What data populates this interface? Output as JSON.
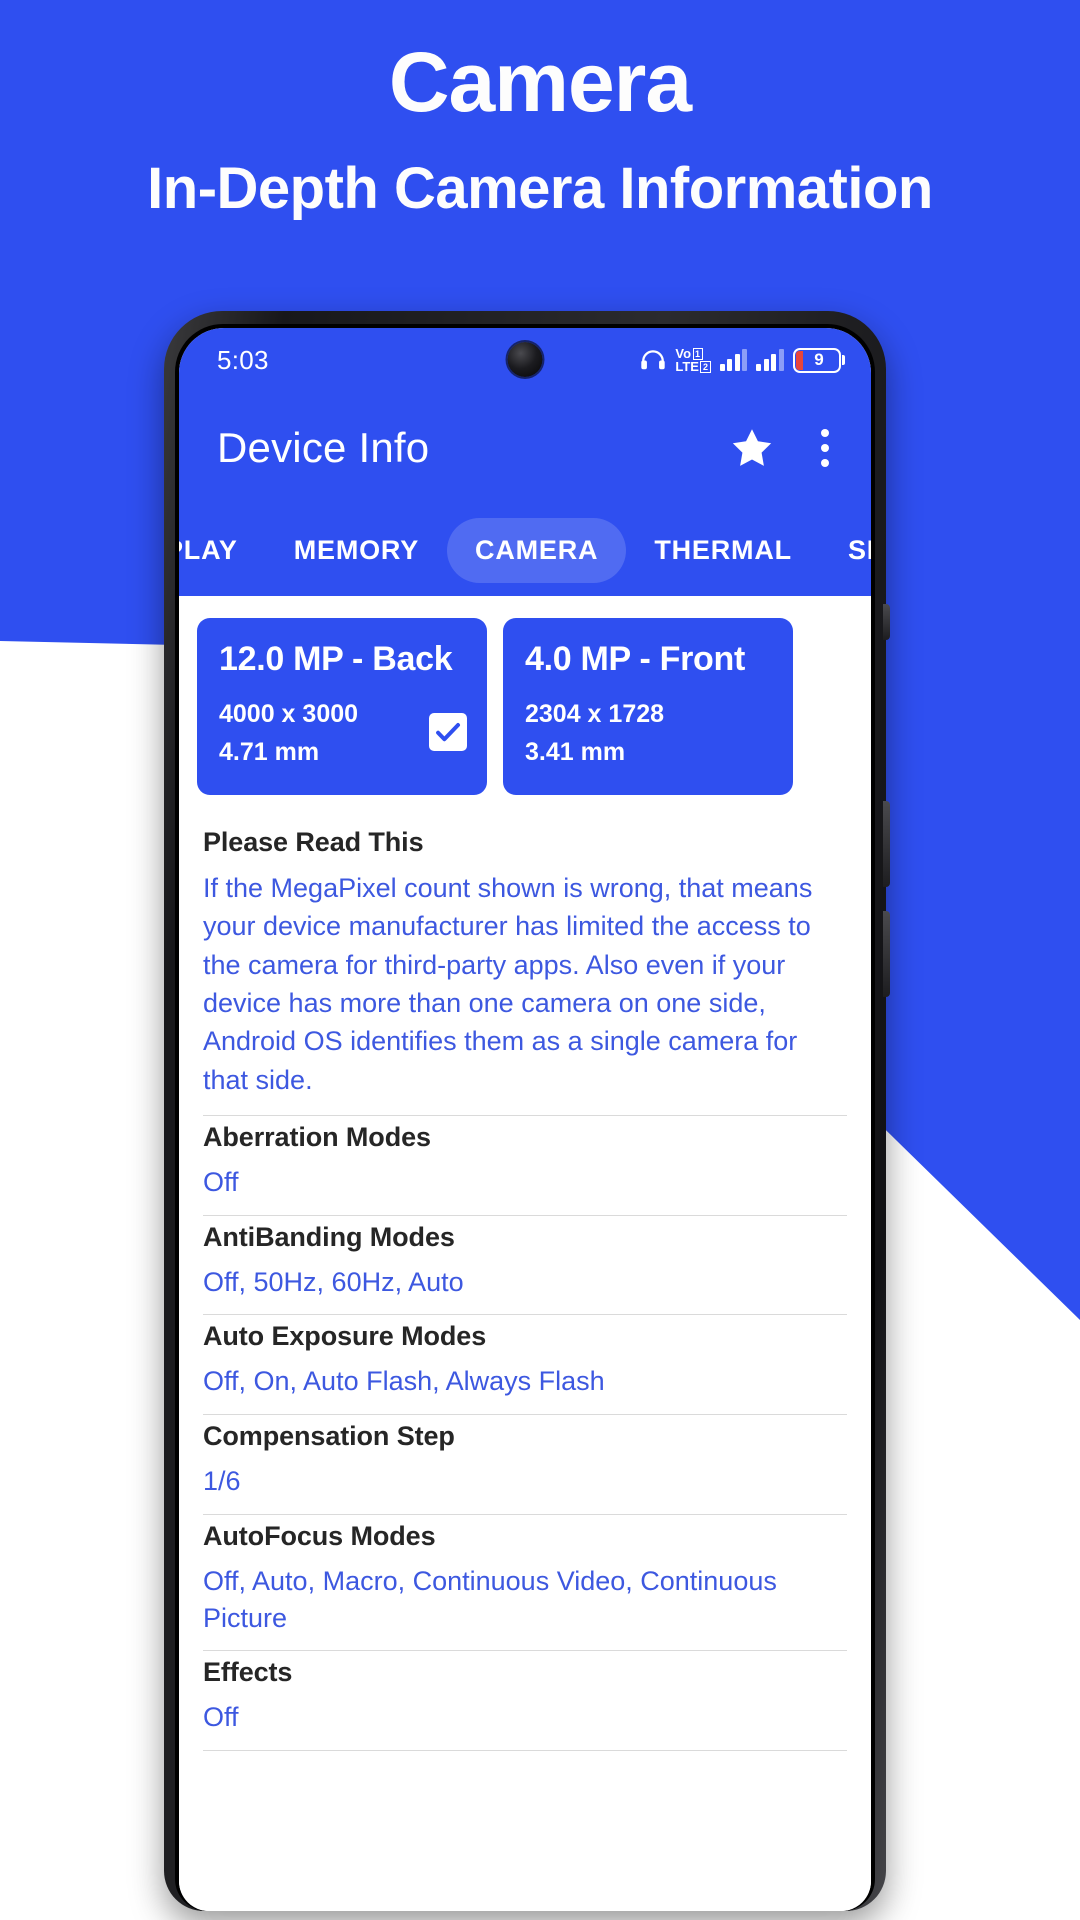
{
  "promo": {
    "title": "Camera",
    "subtitle": "In-Depth Camera Information",
    "accent_color": "#2f4ff0",
    "text_color": "#ffffff"
  },
  "statusbar": {
    "time": "5:03",
    "headset_icon": "headset-icon",
    "volte_label_top": "Vo",
    "volte_label_bottom": "LTE",
    "volte_sim1": "1",
    "volte_sim2": "2",
    "signal_icon_1": "signal-bars-icon",
    "signal_icon_2": "signal-bars-icon",
    "battery_level": "9",
    "punch_hole_icon": "front-camera-icon"
  },
  "appbar": {
    "title": "Device Info",
    "star_icon": "star-icon",
    "overflow_icon": "kebab-menu-icon"
  },
  "tabs": {
    "items": [
      {
        "label": "PLAY",
        "active": false
      },
      {
        "label": "MEMORY",
        "active": false
      },
      {
        "label": "CAMERA",
        "active": true
      },
      {
        "label": "THERMAL",
        "active": false
      },
      {
        "label": "SEN",
        "active": false
      }
    ]
  },
  "camera_cards": [
    {
      "title": "12.0 MP - Back",
      "resolution": "4000 x 3000",
      "focal_length": "4.71 mm",
      "selected": true,
      "check_icon": "check-icon"
    },
    {
      "title": "4.0 MP - Front",
      "resolution": "2304 x 1728",
      "focal_length": "3.41 mm",
      "selected": false,
      "check_icon": "check-icon"
    }
  ],
  "details": [
    {
      "label": "Please Read This",
      "value": "If the MegaPixel count shown is wrong, that means your device manufacturer has limited the access to the camera for third-party apps. Also even if your device has more than one camera on one side, Android OS identifies them as a single camera for that side."
    },
    {
      "label": "Aberration Modes",
      "value": "Off"
    },
    {
      "label": "AntiBanding Modes",
      "value": "Off, 50Hz, 60Hz, Auto"
    },
    {
      "label": "Auto Exposure Modes",
      "value": "Off, On, Auto Flash, Always Flash"
    },
    {
      "label": "Compensation Step",
      "value": "1/6"
    },
    {
      "label": "AutoFocus Modes",
      "value": "Off, Auto, Macro, Continuous Video, Continuous Picture"
    },
    {
      "label": "Effects",
      "value": "Off"
    }
  ]
}
